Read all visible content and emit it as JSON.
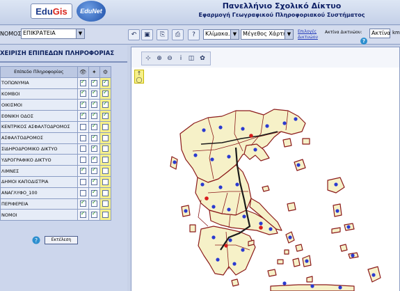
{
  "header": {
    "logo_main": "Edu",
    "logo_main_g": "Gis",
    "logo_secondary": "EduNet",
    "title": "Πανελλήνιο Σχολικό Δίκτυο",
    "subtitle": "Εφαρμογή Γεωγραφικού Πληροφοριακού Συστήματος"
  },
  "toolbar": {
    "nomos_label": "ΝΟΜΟΣ:",
    "nomos_value": "ΕΠΙΚΡΑΤΕΙΑ",
    "scale_value": "Κλίμακα...",
    "map_size_value": "Μέγεθος Χάρτη",
    "options_link_line1": "Επιλογές",
    "options_link_line2": "Δικτυώου",
    "radius_label": "Ακτίνα Δικτυώου:",
    "radius_value": "Ακτίνα",
    "radius_unit": "km"
  },
  "left_panel": {
    "title": "ΧΕΙΡΙΣΗ ΕΠΙΠΕΔΩΝ ΠΛΗΡΟΦΟΡΙΑΣ",
    "table_header": "Επίπεδο Πληροφορίας",
    "layers": [
      {
        "name": "ΤΟΠΩΝΥΜΙΑ",
        "c1": true,
        "c2": true,
        "c3": true
      },
      {
        "name": "ΚΟΜΒΟΙ",
        "c1": true,
        "c2": true,
        "c3": true
      },
      {
        "name": "ΟΙΚΙΣΜΟΙ",
        "c1": true,
        "c2": true,
        "c3": true
      },
      {
        "name": "ΕΘΝΙΚΗ ΟΔΟΣ",
        "c1": true,
        "c2": true,
        "c3": true
      },
      {
        "name": "ΚΕΝΤΡΙΚΟΣ ΑΣΦΑΛΤΟΔΡΟΜΟΣ",
        "c1": false,
        "c2": true,
        "c3": false
      },
      {
        "name": "ΑΣΦΑΛΤΟΔΡΟΜΟΣ",
        "c1": false,
        "c2": true,
        "c3": false
      },
      {
        "name": "ΣΙΔΗΡΟΔΡΟΜΙΚΟ ΔΙΚΤΥΟ",
        "c1": false,
        "c2": true,
        "c3": false
      },
      {
        "name": "ΥΔΡΟΓΡΑΦΙΚΟ ΔΙΚΤΥΟ",
        "c1": false,
        "c2": true,
        "c3": false
      },
      {
        "name": "ΛΙΜΝΕΣ",
        "c1": true,
        "c2": true,
        "c3": false
      },
      {
        "name": "ΔΗΜΟΙ ΚΑΠΟΔΙΣΤΡΙΑ",
        "c1": false,
        "c2": true,
        "c3": false
      },
      {
        "name": "ΑΝΑΓΛΥΦΟ_100",
        "c1": false,
        "c2": true,
        "c3": false
      },
      {
        "name": "ΠΕΡΙΦΕΡΕΙΑ",
        "c1": true,
        "c2": true,
        "c3": false
      },
      {
        "name": "ΝΟΜΟΙ",
        "c1": true,
        "c2": true,
        "c3": false
      }
    ],
    "execute_label": "Εκτέλεση"
  },
  "icons": {
    "back": "back-arrow-icon",
    "save": "save-icon",
    "print": "print-icon",
    "fit": "zoom-full-extent-icon",
    "zoom_in": "zoom-in-icon",
    "zoom_out": "zoom-out-icon",
    "info": "info-icon",
    "measure": "measure-icon",
    "pan": "pan-icon"
  },
  "colors": {
    "prefecture_border": "#8b1a1a",
    "prefecture_fill": "#f6f1c8",
    "marker_blue": "#2a3ad0",
    "marker_red": "#d81c1c",
    "highlight_yellow": "#f6f08a"
  }
}
